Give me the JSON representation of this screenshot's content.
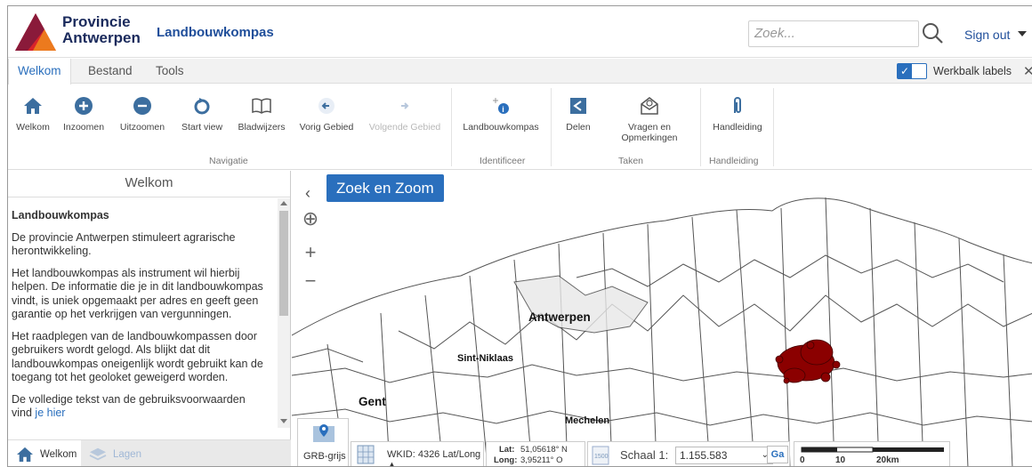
{
  "brand": {
    "logo_line1": "Provincie",
    "logo_line2": "Antwerpen",
    "app_title": "Landbouwkompas",
    "colors": {
      "accent": "#2a6fbd",
      "navy": "#1a2a5c",
      "logo_red": "#d8232a",
      "logo_orange": "#f08a1c"
    }
  },
  "header": {
    "search_placeholder": "Zoek...",
    "search_icon": "search-icon",
    "sign_out": "Sign out"
  },
  "tabs": [
    {
      "label": "Welkom",
      "active": true
    },
    {
      "label": "Bestand",
      "active": false
    },
    {
      "label": "Tools",
      "active": false
    }
  ],
  "toolbar_labels": {
    "label": "Werkbalk labels",
    "checked": true
  },
  "ribbon": {
    "buttons": [
      {
        "label": "Welkom",
        "icon": "home-icon"
      },
      {
        "label": "Inzoomen",
        "icon": "plus-circle-icon"
      },
      {
        "label": "Uitzoomen",
        "icon": "minus-circle-icon"
      },
      {
        "label": "Start view",
        "icon": "refresh-icon"
      },
      {
        "label": "Bladwijzers",
        "icon": "book-icon"
      },
      {
        "label": "Vorig Gebied",
        "icon": "back-arrow-icon"
      },
      {
        "label": "Volgende Gebied",
        "icon": "forward-arrow-icon",
        "disabled": true
      },
      {
        "label": "Landbouwkompas",
        "icon": "identify-icon"
      },
      {
        "label": "Delen",
        "icon": "share-icon"
      },
      {
        "label": "Vragen en Opmerkingen",
        "icon": "mail-icon"
      },
      {
        "label": "Handleiding",
        "icon": "paperclip-icon"
      }
    ],
    "groups": [
      "Navigatie",
      "Identificeer",
      "Taken",
      "Handleiding"
    ]
  },
  "left_panel": {
    "title": "Welkom",
    "heading": "Landbouwkompas",
    "paragraphs": [
      "De provincie Antwerpen stimuleert agrarische herontwikkeling.",
      "Het landbouwkompas als instrument wil hierbij helpen. De informatie die je in dit landbouwkompas vindt, is uniek opgemaakt per adres en geeft geen garantie op het verkrijgen van vergunningen.",
      "Het raadplegen van de landbouwkompassen door gebruikers wordt gelogd. Als blijkt dat dit landbouwkompas oneigenlijk wordt gebruikt kan de toegang tot het geoloket geweigerd worden.",
      "De volledige tekst van de gebruiksvoorwaarden vind"
    ],
    "last_link": "je hier",
    "footer_tabs": [
      {
        "label": "Welkom",
        "icon": "home-icon",
        "active": true
      },
      {
        "label": "Lagen",
        "icon": "layers-icon",
        "active": false
      }
    ]
  },
  "map": {
    "search_zoom_button": "Zoek en Zoom",
    "places": [
      "Antwerpen",
      "Sint-Niklaas",
      "Gent",
      "Mechelen"
    ],
    "cluster_color": "#8b0000"
  },
  "statusbar": {
    "basemap": "GRB-grijs",
    "crs": "WKID: 4326 Lat/Long ▲",
    "lat_label": "Lat:",
    "lat_value": "51,05618° N",
    "long_label": "Long:",
    "long_value": "3,95211° O",
    "scale_label": "Schaal 1:",
    "scale_value": "1.155.583",
    "go": "Ga",
    "scalebar": [
      "0",
      "10",
      "20km"
    ]
  }
}
